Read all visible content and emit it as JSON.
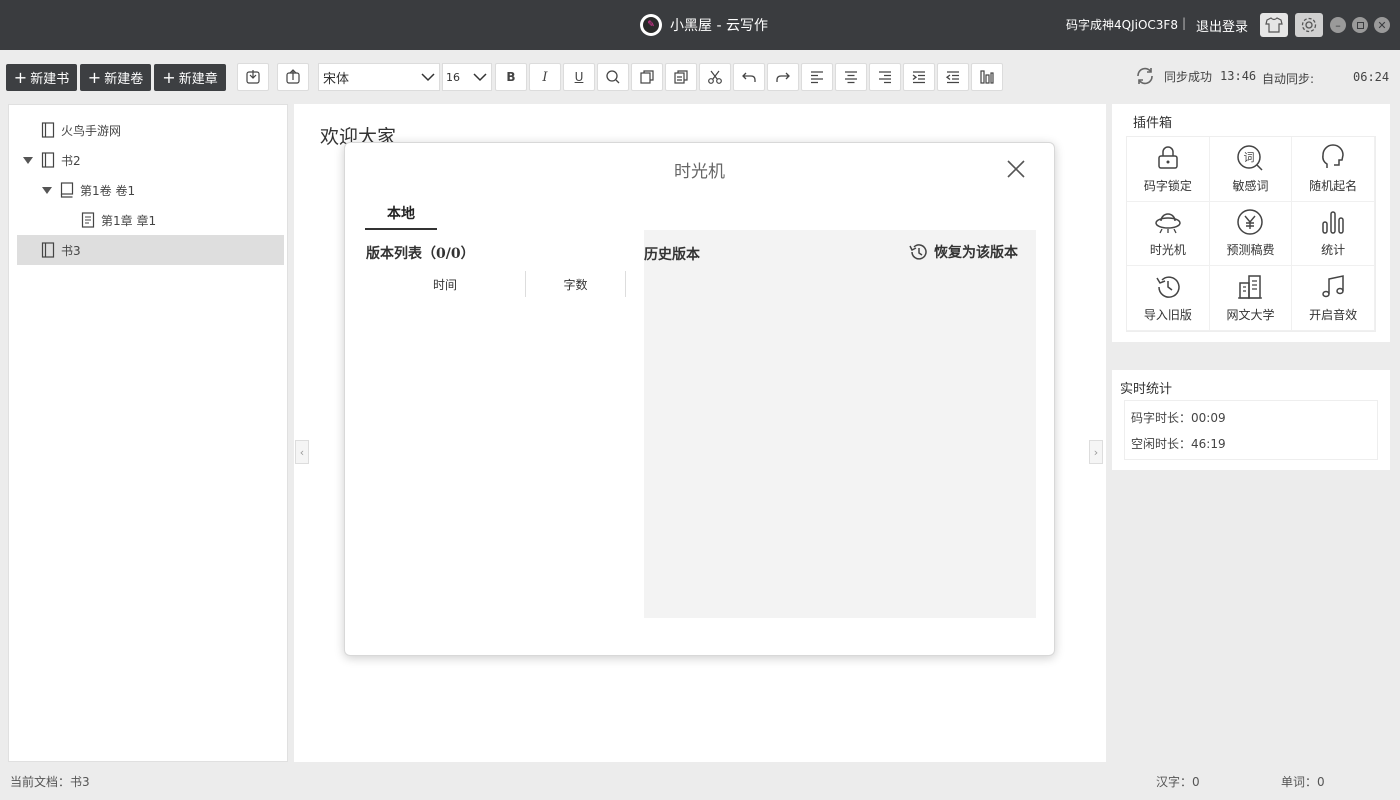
{
  "titlebar": {
    "app_title": "小黑屋 - 云写作",
    "user": "码字成神4QJiOC3F8",
    "separator": "|",
    "logout": "退出登录"
  },
  "toolbar": {
    "new_book": "新建书",
    "new_volume": "新建卷",
    "new_chapter": "新建章",
    "font_family": "宋体",
    "font_size": "16",
    "bold": "B",
    "italic": "I",
    "underline": "U",
    "sync_status": "同步成功",
    "sync_time": "13:46",
    "auto_sync_label": "自动同步:",
    "auto_sync_time": "06:24"
  },
  "tree": {
    "items": [
      {
        "label": "火鸟手游网"
      },
      {
        "label": "书2"
      },
      {
        "label": "第1卷 卷1"
      },
      {
        "label": "第1章 章1"
      },
      {
        "label": "书3"
      }
    ]
  },
  "editor": {
    "title": "欢迎大家"
  },
  "modal": {
    "title": "时光机",
    "tab_local": "本地",
    "version_list_title": "版本列表（0/0）",
    "col_time": "时间",
    "col_words": "字数",
    "history_title": "历史版本",
    "restore_button": "恢复为该版本"
  },
  "plugins": {
    "title": "插件箱",
    "items": [
      {
        "label": "码字锁定",
        "icon": "lock-icon"
      },
      {
        "label": "敏感词",
        "icon": "sensitive-word-icon"
      },
      {
        "label": "随机起名",
        "icon": "head-icon"
      },
      {
        "label": "时光机",
        "icon": "ufo-icon"
      },
      {
        "label": "预测稿费",
        "icon": "yen-icon"
      },
      {
        "label": "统计",
        "icon": "bar-chart-icon"
      },
      {
        "label": "导入旧版",
        "icon": "history-import-icon"
      },
      {
        "label": "网文大学",
        "icon": "building-icon"
      },
      {
        "label": "开启音效",
        "icon": "music-icon"
      }
    ]
  },
  "stats": {
    "title": "实时统计",
    "typing_time": "码字时长：00:09",
    "idle_time": "空闲时长：46:19"
  },
  "statusbar": {
    "current_doc": "当前文档：书3",
    "han_chars": "汉字：0",
    "words": "单词：0"
  }
}
